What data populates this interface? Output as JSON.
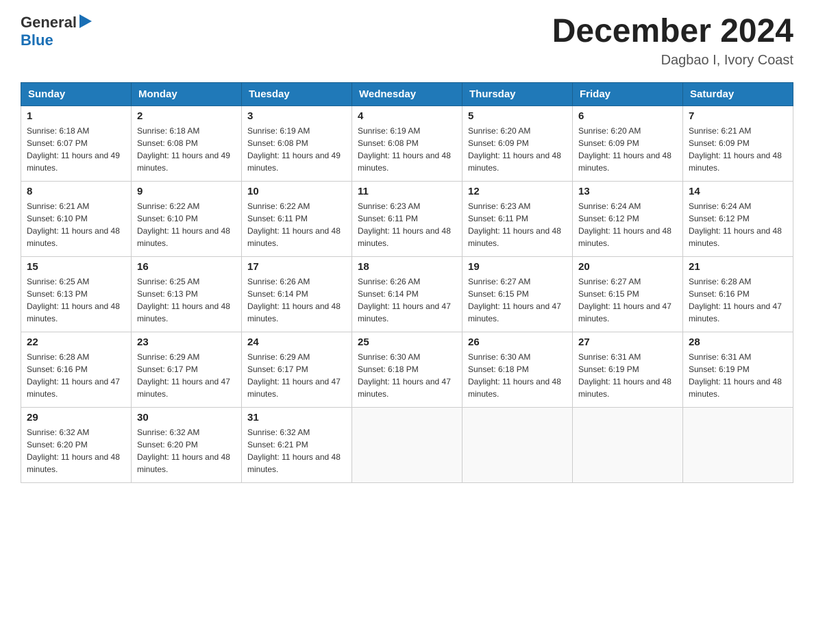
{
  "logo": {
    "general": "General",
    "blue": "Blue"
  },
  "title": "December 2024",
  "location": "Dagbao I, Ivory Coast",
  "headers": [
    "Sunday",
    "Monday",
    "Tuesday",
    "Wednesday",
    "Thursday",
    "Friday",
    "Saturday"
  ],
  "weeks": [
    [
      {
        "day": "1",
        "sunrise": "Sunrise: 6:18 AM",
        "sunset": "Sunset: 6:07 PM",
        "daylight": "Daylight: 11 hours and 49 minutes."
      },
      {
        "day": "2",
        "sunrise": "Sunrise: 6:18 AM",
        "sunset": "Sunset: 6:08 PM",
        "daylight": "Daylight: 11 hours and 49 minutes."
      },
      {
        "day": "3",
        "sunrise": "Sunrise: 6:19 AM",
        "sunset": "Sunset: 6:08 PM",
        "daylight": "Daylight: 11 hours and 49 minutes."
      },
      {
        "day": "4",
        "sunrise": "Sunrise: 6:19 AM",
        "sunset": "Sunset: 6:08 PM",
        "daylight": "Daylight: 11 hours and 48 minutes."
      },
      {
        "day": "5",
        "sunrise": "Sunrise: 6:20 AM",
        "sunset": "Sunset: 6:09 PM",
        "daylight": "Daylight: 11 hours and 48 minutes."
      },
      {
        "day": "6",
        "sunrise": "Sunrise: 6:20 AM",
        "sunset": "Sunset: 6:09 PM",
        "daylight": "Daylight: 11 hours and 48 minutes."
      },
      {
        "day": "7",
        "sunrise": "Sunrise: 6:21 AM",
        "sunset": "Sunset: 6:09 PM",
        "daylight": "Daylight: 11 hours and 48 minutes."
      }
    ],
    [
      {
        "day": "8",
        "sunrise": "Sunrise: 6:21 AM",
        "sunset": "Sunset: 6:10 PM",
        "daylight": "Daylight: 11 hours and 48 minutes."
      },
      {
        "day": "9",
        "sunrise": "Sunrise: 6:22 AM",
        "sunset": "Sunset: 6:10 PM",
        "daylight": "Daylight: 11 hours and 48 minutes."
      },
      {
        "day": "10",
        "sunrise": "Sunrise: 6:22 AM",
        "sunset": "Sunset: 6:11 PM",
        "daylight": "Daylight: 11 hours and 48 minutes."
      },
      {
        "day": "11",
        "sunrise": "Sunrise: 6:23 AM",
        "sunset": "Sunset: 6:11 PM",
        "daylight": "Daylight: 11 hours and 48 minutes."
      },
      {
        "day": "12",
        "sunrise": "Sunrise: 6:23 AM",
        "sunset": "Sunset: 6:11 PM",
        "daylight": "Daylight: 11 hours and 48 minutes."
      },
      {
        "day": "13",
        "sunrise": "Sunrise: 6:24 AM",
        "sunset": "Sunset: 6:12 PM",
        "daylight": "Daylight: 11 hours and 48 minutes."
      },
      {
        "day": "14",
        "sunrise": "Sunrise: 6:24 AM",
        "sunset": "Sunset: 6:12 PM",
        "daylight": "Daylight: 11 hours and 48 minutes."
      }
    ],
    [
      {
        "day": "15",
        "sunrise": "Sunrise: 6:25 AM",
        "sunset": "Sunset: 6:13 PM",
        "daylight": "Daylight: 11 hours and 48 minutes."
      },
      {
        "day": "16",
        "sunrise": "Sunrise: 6:25 AM",
        "sunset": "Sunset: 6:13 PM",
        "daylight": "Daylight: 11 hours and 48 minutes."
      },
      {
        "day": "17",
        "sunrise": "Sunrise: 6:26 AM",
        "sunset": "Sunset: 6:14 PM",
        "daylight": "Daylight: 11 hours and 48 minutes."
      },
      {
        "day": "18",
        "sunrise": "Sunrise: 6:26 AM",
        "sunset": "Sunset: 6:14 PM",
        "daylight": "Daylight: 11 hours and 47 minutes."
      },
      {
        "day": "19",
        "sunrise": "Sunrise: 6:27 AM",
        "sunset": "Sunset: 6:15 PM",
        "daylight": "Daylight: 11 hours and 47 minutes."
      },
      {
        "day": "20",
        "sunrise": "Sunrise: 6:27 AM",
        "sunset": "Sunset: 6:15 PM",
        "daylight": "Daylight: 11 hours and 47 minutes."
      },
      {
        "day": "21",
        "sunrise": "Sunrise: 6:28 AM",
        "sunset": "Sunset: 6:16 PM",
        "daylight": "Daylight: 11 hours and 47 minutes."
      }
    ],
    [
      {
        "day": "22",
        "sunrise": "Sunrise: 6:28 AM",
        "sunset": "Sunset: 6:16 PM",
        "daylight": "Daylight: 11 hours and 47 minutes."
      },
      {
        "day": "23",
        "sunrise": "Sunrise: 6:29 AM",
        "sunset": "Sunset: 6:17 PM",
        "daylight": "Daylight: 11 hours and 47 minutes."
      },
      {
        "day": "24",
        "sunrise": "Sunrise: 6:29 AM",
        "sunset": "Sunset: 6:17 PM",
        "daylight": "Daylight: 11 hours and 47 minutes."
      },
      {
        "day": "25",
        "sunrise": "Sunrise: 6:30 AM",
        "sunset": "Sunset: 6:18 PM",
        "daylight": "Daylight: 11 hours and 47 minutes."
      },
      {
        "day": "26",
        "sunrise": "Sunrise: 6:30 AM",
        "sunset": "Sunset: 6:18 PM",
        "daylight": "Daylight: 11 hours and 48 minutes."
      },
      {
        "day": "27",
        "sunrise": "Sunrise: 6:31 AM",
        "sunset": "Sunset: 6:19 PM",
        "daylight": "Daylight: 11 hours and 48 minutes."
      },
      {
        "day": "28",
        "sunrise": "Sunrise: 6:31 AM",
        "sunset": "Sunset: 6:19 PM",
        "daylight": "Daylight: 11 hours and 48 minutes."
      }
    ],
    [
      {
        "day": "29",
        "sunrise": "Sunrise: 6:32 AM",
        "sunset": "Sunset: 6:20 PM",
        "daylight": "Daylight: 11 hours and 48 minutes."
      },
      {
        "day": "30",
        "sunrise": "Sunrise: 6:32 AM",
        "sunset": "Sunset: 6:20 PM",
        "daylight": "Daylight: 11 hours and 48 minutes."
      },
      {
        "day": "31",
        "sunrise": "Sunrise: 6:32 AM",
        "sunset": "Sunset: 6:21 PM",
        "daylight": "Daylight: 11 hours and 48 minutes."
      },
      {
        "day": "",
        "sunrise": "",
        "sunset": "",
        "daylight": ""
      },
      {
        "day": "",
        "sunrise": "",
        "sunset": "",
        "daylight": ""
      },
      {
        "day": "",
        "sunrise": "",
        "sunset": "",
        "daylight": ""
      },
      {
        "day": "",
        "sunrise": "",
        "sunset": "",
        "daylight": ""
      }
    ]
  ]
}
